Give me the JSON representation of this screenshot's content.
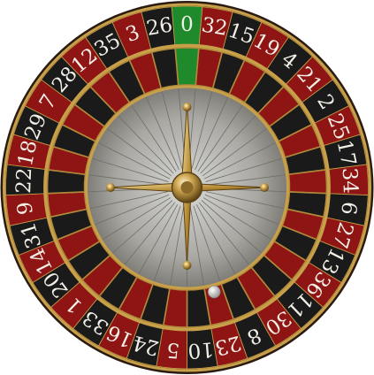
{
  "wheel": {
    "numbers": [
      "0",
      "32",
      "15",
      "19",
      "4",
      "21",
      "2",
      "25",
      "17",
      "34",
      "6",
      "27",
      "13",
      "36",
      "11",
      "30",
      "8",
      "23",
      "10",
      "5",
      "24",
      "16",
      "33",
      "1",
      "20",
      "14",
      "31",
      "9",
      "22",
      "18",
      "29",
      "7",
      "28",
      "12",
      "35",
      "3",
      "26"
    ],
    "reds": [
      "32",
      "19",
      "21",
      "25",
      "34",
      "27",
      "36",
      "30",
      "23",
      "5",
      "16",
      "1",
      "14",
      "9",
      "18",
      "7",
      "12",
      "3"
    ]
  },
  "colors": {
    "red": "#8f1414",
    "black": "#1a1a1a",
    "green": "#1e8a2c",
    "gold": "#c8a04a",
    "wood": "#3b2414"
  },
  "ball": {
    "pocket": "23"
  }
}
